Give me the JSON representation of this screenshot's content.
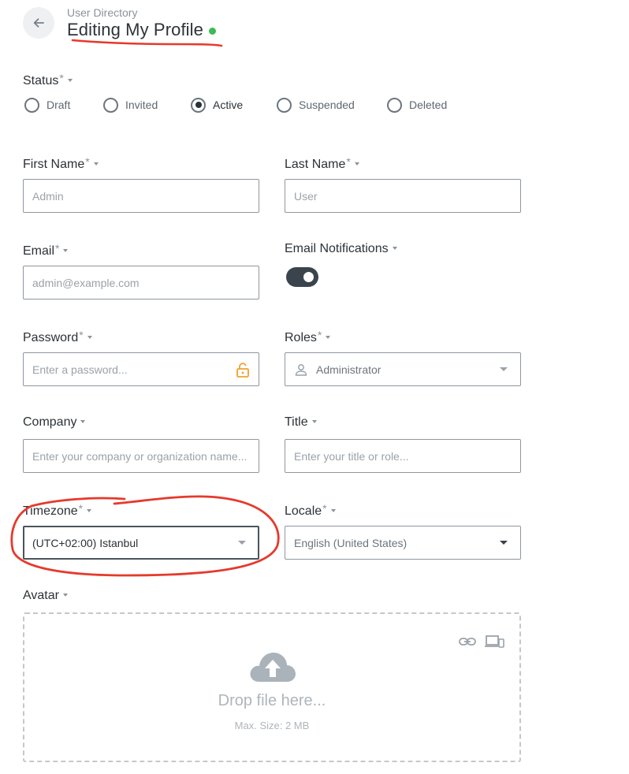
{
  "header": {
    "breadcrumb": "User Directory",
    "title": "Editing My Profile",
    "online_color": "#3dba54"
  },
  "status": {
    "label": "Status",
    "required_mark": "*",
    "options": [
      {
        "label": "Draft",
        "checked": false
      },
      {
        "label": "Invited",
        "checked": false
      },
      {
        "label": "Active",
        "checked": true
      },
      {
        "label": "Suspended",
        "checked": false
      },
      {
        "label": "Deleted",
        "checked": false
      }
    ]
  },
  "fields": {
    "first_name": {
      "label": "First Name",
      "required_mark": "*",
      "placeholder": "Admin",
      "value": ""
    },
    "last_name": {
      "label": "Last Name",
      "required_mark": "*",
      "placeholder": "User",
      "value": ""
    },
    "email": {
      "label": "Email",
      "required_mark": "*",
      "placeholder": "admin@example.com",
      "value": ""
    },
    "email_notifications": {
      "label": "Email Notifications",
      "enabled": true
    },
    "password": {
      "label": "Password",
      "required_mark": "*",
      "placeholder": "Enter a password...",
      "value": ""
    },
    "roles": {
      "label": "Roles",
      "required_mark": "*",
      "value": "Administrator"
    },
    "company": {
      "label": "Company",
      "placeholder": "Enter your company or organization name...",
      "value": ""
    },
    "title": {
      "label": "Title",
      "placeholder": "Enter your title or role...",
      "value": ""
    },
    "timezone": {
      "label": "Timezone",
      "required_mark": "*",
      "value": "(UTC+02:00) Istanbul"
    },
    "locale": {
      "label": "Locale",
      "required_mark": "*",
      "value": "English (United States)"
    },
    "avatar": {
      "label": "Avatar",
      "drop_text": "Drop file here...",
      "max_size": "Max. Size: 2 MB"
    }
  },
  "colors": {
    "annotation": "#e53a2c",
    "lock_icon": "#f0a030",
    "toggle_on": "#3a444c"
  },
  "icons": {
    "back": "arrow-left-icon",
    "lock": "lock-open-icon",
    "user": "user-icon",
    "upload": "cloud-upload-icon",
    "link": "link-icon",
    "device": "devices-icon"
  }
}
